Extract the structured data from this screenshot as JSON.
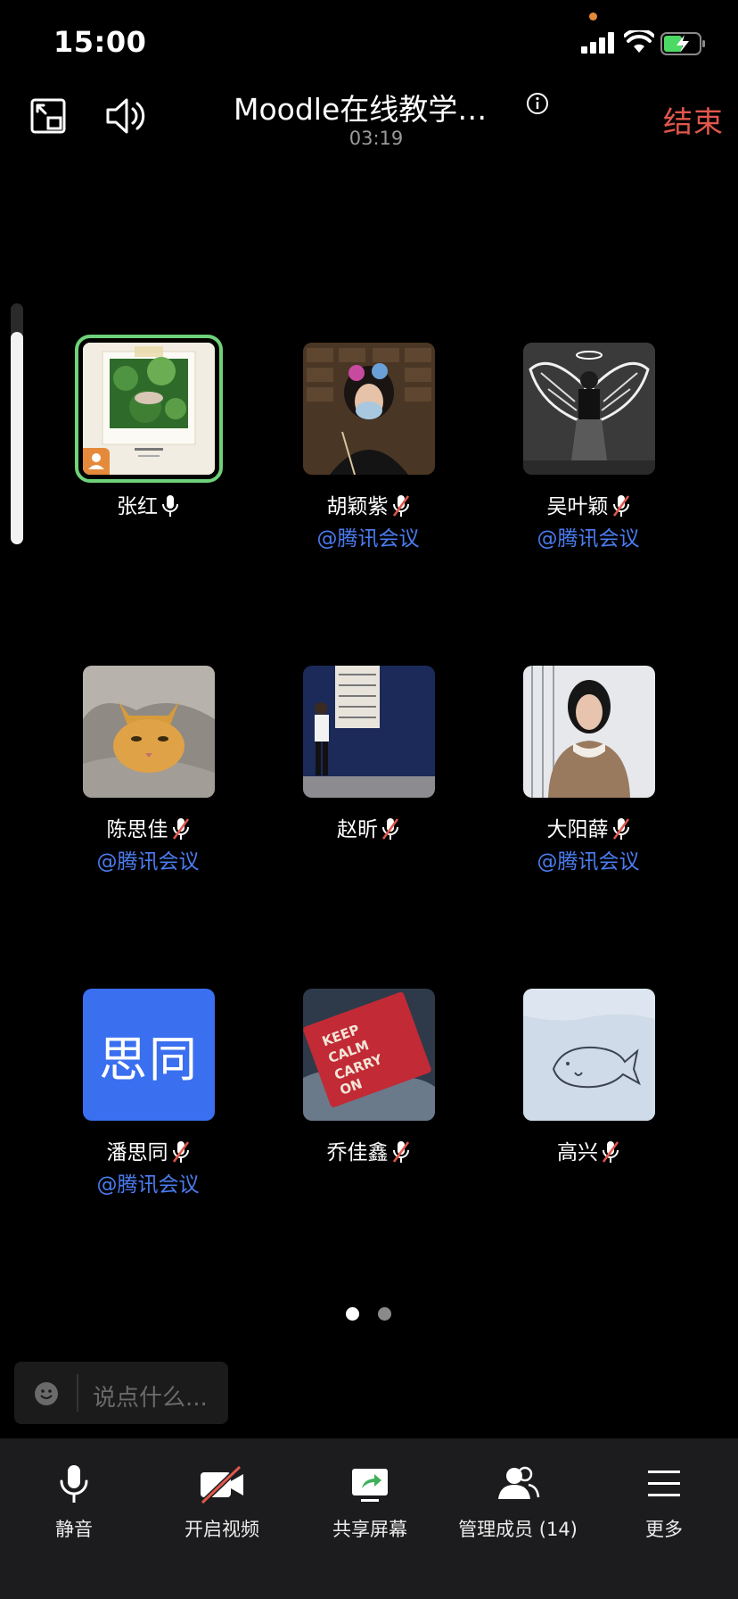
{
  "status_bar": {
    "time": "15:00"
  },
  "header": {
    "meeting_title": "Moodle在线教学平台",
    "timer": "03:19",
    "end_label": "结束"
  },
  "participants": [
    {
      "name": "张红",
      "tag": "",
      "mic": "on",
      "host": true
    },
    {
      "name": "胡颖紫",
      "tag": "@腾讯会议",
      "mic": "muted"
    },
    {
      "name": "吴叶颖",
      "tag": "@腾讯会议",
      "mic": "muted"
    },
    {
      "name": "陈思佳",
      "tag": "@腾讯会议",
      "mic": "muted"
    },
    {
      "name": "赵昕",
      "tag": "",
      "mic": "muted"
    },
    {
      "name": "大阳薛",
      "tag": "@腾讯会议",
      "mic": "muted"
    },
    {
      "name": "潘思同",
      "tag": "@腾讯会议",
      "mic": "muted",
      "avatar_text": "思同",
      "avatar_color": "#3a6ff0"
    },
    {
      "name": "乔佳鑫",
      "tag": "",
      "mic": "muted"
    },
    {
      "name": "高兴",
      "tag": "",
      "mic": "muted"
    }
  ],
  "pagination": {
    "current": 1,
    "total": 2
  },
  "chat": {
    "placeholder": "说点什么..."
  },
  "toolbar": {
    "mute": "静音",
    "video": "开启视频",
    "share": "共享屏幕",
    "members": "管理成员 (14)",
    "more": "更多"
  },
  "colors": {
    "end": "#e2574c",
    "tag": "#4b7cf0",
    "active_speaker": "#6fd17a",
    "host_badge": "#e58a3a"
  }
}
